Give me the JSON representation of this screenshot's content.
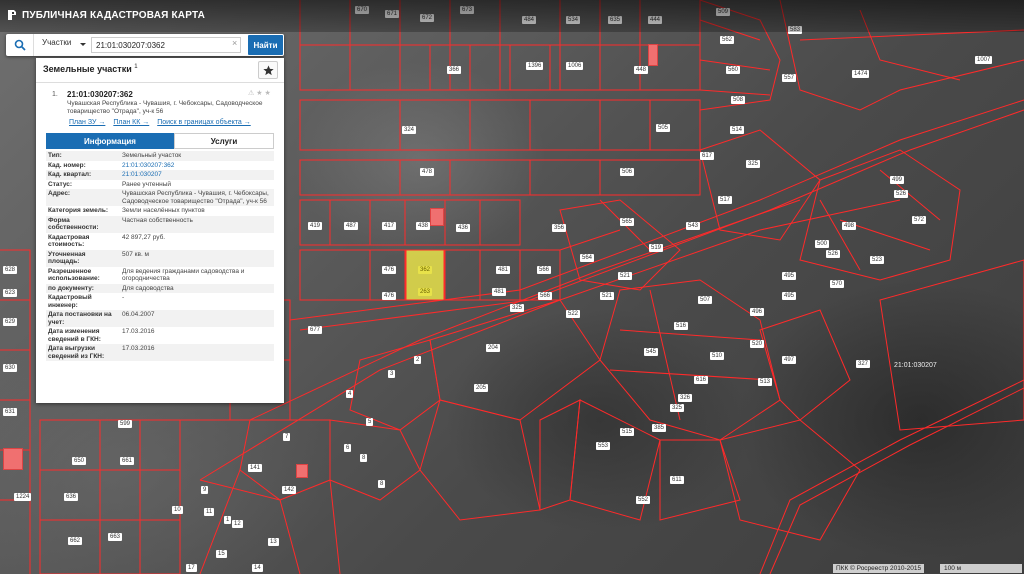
{
  "header": {
    "title": "ПУБЛИЧНАЯ КАДАСТРОВАЯ КАРТА",
    "logo_icon": "map-logo-icon"
  },
  "search": {
    "scope": "Участки",
    "value": "21:01:030207:0362",
    "button_label": "Найти",
    "icon": "search-icon",
    "clear_icon": "×"
  },
  "panel": {
    "title": "Земельные участки",
    "count": "1",
    "star_icon": "star-icon",
    "result": {
      "index": "1.",
      "cad_number": "21:01:030207:362",
      "address": "Чувашская Республика - Чувашия, г. Чебоксары, Садоводческое товарищество \"Отрада\", уч-к 56",
      "links": [
        "План ЗУ →",
        "План КК →",
        "Поиск в границах объекта →"
      ],
      "tools": "⚠ ★ ★"
    },
    "tabs": {
      "info": "Информация",
      "services": "Услуги"
    },
    "attributes": [
      {
        "k": "Тип:",
        "v": "Земельный участок"
      },
      {
        "k": "Кад. номер:",
        "v": "21:01:030207:362"
      },
      {
        "k": "Кад. квартал:",
        "v": "21:01:030207"
      },
      {
        "k": "Статус:",
        "v": "Ранее учтенный"
      },
      {
        "k": "Адрес:",
        "v": "Чувашская Республика - Чувашия, г. Чебоксары, Садоводческое товарищество \"Отрада\", уч-к 56"
      },
      {
        "k": "Категория земель:",
        "v": "Земли населённых пунктов"
      },
      {
        "k": "Форма собственности:",
        "v": "Частная собственность"
      },
      {
        "k": "Кадастровая стоимость:",
        "v": "42 897,27 руб."
      },
      {
        "k": "Уточненная площадь:",
        "v": "507 кв. м"
      },
      {
        "k": "Разрешенное использование:",
        "v": "Для ведения гражданами садоводства и огородничества"
      },
      {
        "k": "по документу:",
        "v": "Для садоводства"
      },
      {
        "k": "Кадастровый инженер:",
        "v": "-"
      },
      {
        "k": "Дата постановки на учет:",
        "v": "06.04.2007"
      },
      {
        "k": "Дата изменения сведений в ГКН:",
        "v": "17.03.2016"
      },
      {
        "k": "Дата выгрузки сведений из ГКН:",
        "v": "17.03.2016"
      }
    ]
  },
  "map": {
    "quarter": "21:01:030207",
    "selected_plot": "362",
    "plots": [
      "670",
      "671",
      "672",
      "673",
      "484",
      "534",
      "635",
      "444",
      "509",
      "562",
      "583",
      "1007",
      "366",
      "1396",
      "1006",
      "448",
      "560",
      "557",
      "1474",
      "508",
      "324",
      "505",
      "514",
      "325",
      "617",
      "478",
      "506",
      "499",
      "526",
      "517",
      "572",
      "419",
      "487",
      "417",
      "438",
      "436",
      "356",
      "565",
      "543",
      "519",
      "498",
      "500",
      "526",
      "495",
      "523",
      "570",
      "476",
      "362",
      "481",
      "566",
      "564",
      "521",
      "476",
      "263",
      "481",
      "325",
      "566",
      "522",
      "521",
      "507",
      "516",
      "495",
      "496",
      "497",
      "520",
      "204",
      "677",
      "2",
      "3",
      "545",
      "510",
      "513",
      "327",
      "205",
      "616",
      "326",
      "325",
      "6",
      "4",
      "5",
      "385",
      "553",
      "515",
      "611",
      "552",
      "7",
      "141",
      "142",
      "8",
      "9",
      "10",
      "11",
      "12",
      "13",
      "14",
      "15",
      "17",
      "628",
      "623",
      "629",
      "630",
      "631",
      "650",
      "661",
      "636",
      "1224",
      "662",
      "663",
      "599",
      "1",
      "8"
    ],
    "selection_color": "#e8e24a",
    "boundary_color": "#ff2a2a"
  },
  "footer": {
    "copyright": "ПКК © Росреестр 2010-2015",
    "scale": "100 м"
  }
}
